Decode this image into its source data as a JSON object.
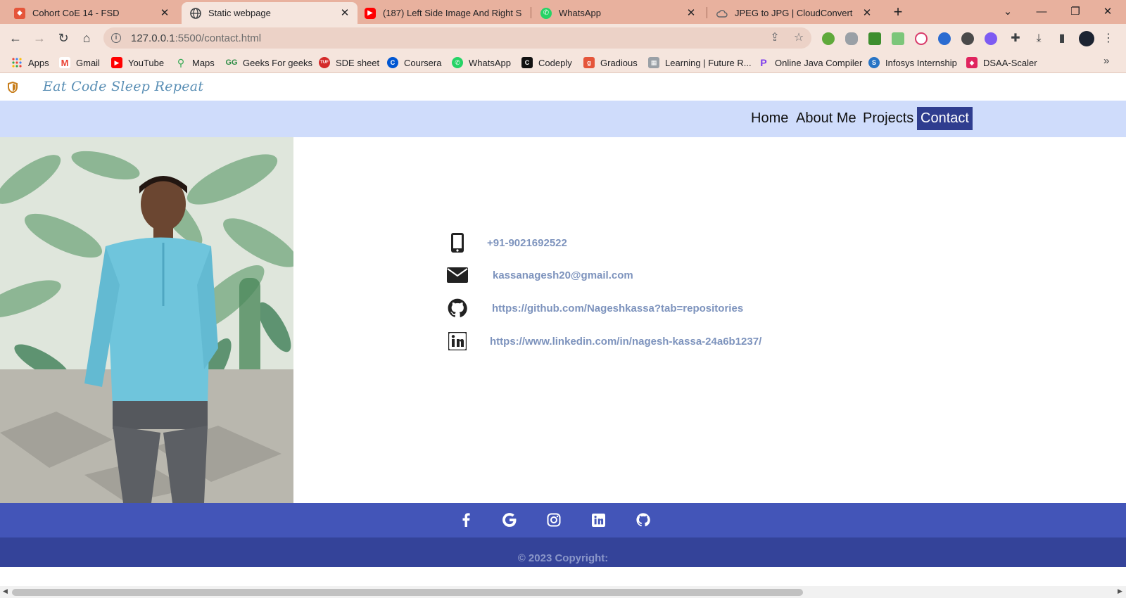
{
  "browser": {
    "tabs": [
      {
        "title": "Cohort CoE 14 - FSD",
        "active": false,
        "icon": "shield-icon",
        "color": "#e5553a"
      },
      {
        "title": "Static webpage",
        "active": true,
        "icon": "globe-icon",
        "color": "#3c4043"
      },
      {
        "title": "(187) Left Side Image And Right S",
        "active": false,
        "icon": "youtube-icon",
        "color": "#ff0000"
      },
      {
        "title": "WhatsApp",
        "active": false,
        "icon": "whatsapp-icon",
        "color": "#25d366"
      },
      {
        "title": "JPEG to JPG | CloudConvert",
        "active": false,
        "icon": "cloud-icon",
        "color": "#5f6368"
      }
    ],
    "url_host": "127.0.0.1",
    "url_path": ":5500/contact.html",
    "bookmarks": [
      {
        "label": "Apps",
        "icon": "apps-grid-icon"
      },
      {
        "label": "Gmail",
        "icon": "gmail-icon"
      },
      {
        "label": "YouTube",
        "icon": "youtube-icon"
      },
      {
        "label": "Maps",
        "icon": "maps-icon"
      },
      {
        "label": "Geeks For geeks",
        "icon": "gfg-icon"
      },
      {
        "label": "SDE sheet",
        "icon": "tuf-icon"
      },
      {
        "label": "Coursera",
        "icon": "coursera-icon"
      },
      {
        "label": "WhatsApp",
        "icon": "whatsapp-icon"
      },
      {
        "label": "Codeply",
        "icon": "codeply-icon"
      },
      {
        "label": "Gradious",
        "icon": "gradious-icon"
      },
      {
        "label": "Learning | Future R...",
        "icon": "futureready-icon"
      },
      {
        "label": "Online Java Compiler",
        "icon": "compiler-icon"
      },
      {
        "label": "Infosys Internship",
        "icon": "infosys-icon"
      },
      {
        "label": "DSAA-Scaler",
        "icon": "scaler-icon"
      }
    ]
  },
  "site": {
    "brand": "Eat Code Sleep Repeat",
    "nav": [
      {
        "label": "Home",
        "active": false
      },
      {
        "label": "About Me",
        "active": false
      },
      {
        "label": "Projects",
        "active": false
      },
      {
        "label": "Contact",
        "active": true
      }
    ],
    "contacts": [
      {
        "icon": "mobile-phone-icon",
        "text": "+91-9021692522"
      },
      {
        "icon": "envelope-icon",
        "text": "kassanagesh20@gmail.com"
      },
      {
        "icon": "github-icon",
        "text": "https://github.com/Nageshkassa?tab=repositories"
      },
      {
        "icon": "linkedin-icon",
        "text": "https://www.linkedin.com/in/nagesh-kassa-24a6b1237/"
      }
    ],
    "social": [
      "facebook-icon",
      "google-icon",
      "instagram-icon",
      "linkedin-icon",
      "github-icon"
    ],
    "copyright": "© 2023 Copyright:",
    "colors": {
      "navbar": "#cfdcfb",
      "nav_active": "#2f3d8f",
      "footer_social": "#4355b8",
      "footer_copy": "#344399",
      "contact_text": "#7d93bd"
    }
  }
}
